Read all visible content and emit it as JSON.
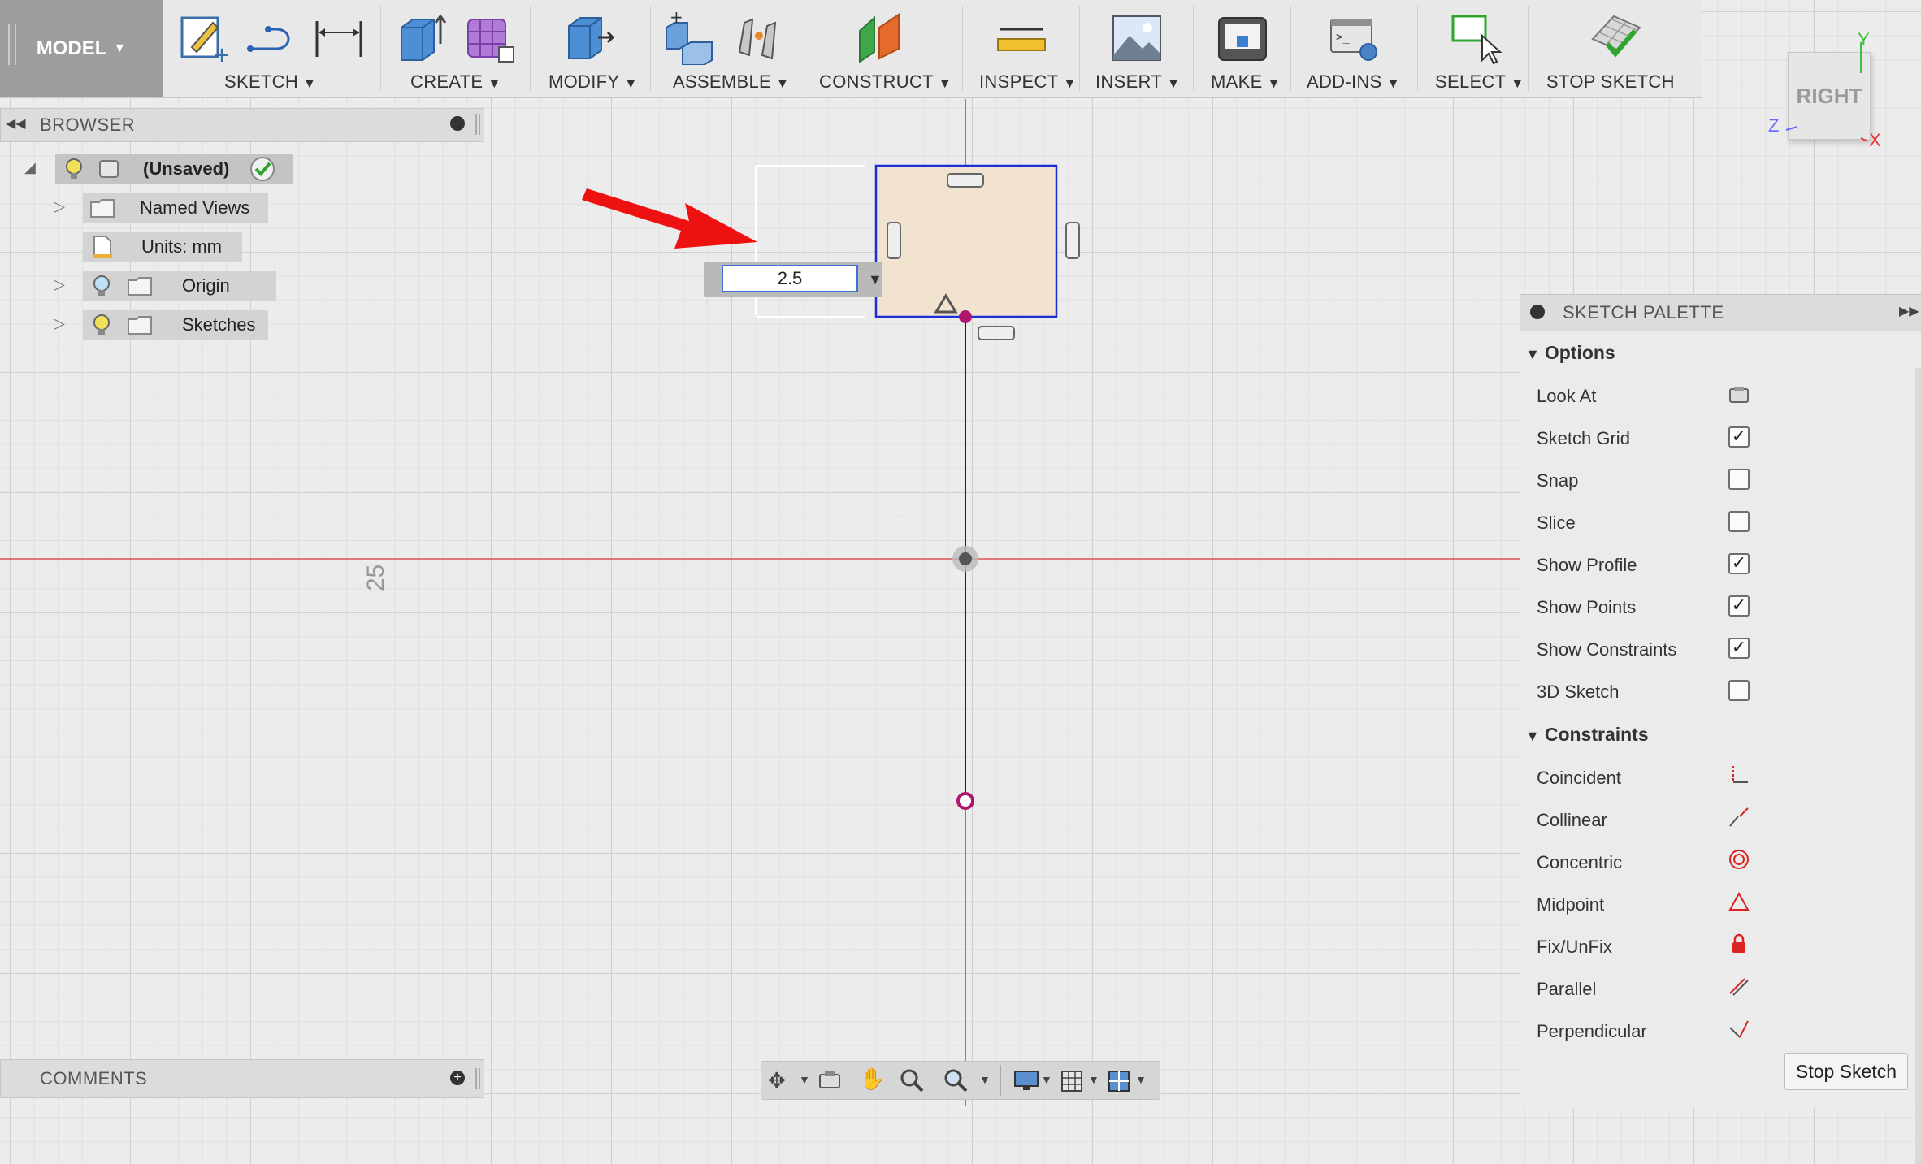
{
  "toolbar": {
    "model_label": "MODEL",
    "groups": [
      {
        "label": "SKETCH"
      },
      {
        "label": "CREATE"
      },
      {
        "label": "MODIFY"
      },
      {
        "label": "ASSEMBLE"
      },
      {
        "label": "CONSTRUCT"
      },
      {
        "label": "INSPECT"
      },
      {
        "label": "INSERT"
      },
      {
        "label": "MAKE"
      },
      {
        "label": "ADD-INS"
      },
      {
        "label": "SELECT"
      },
      {
        "label": "STOP SKETCH"
      }
    ]
  },
  "viewcube": {
    "face": "RIGHT",
    "axis_y": "Y",
    "axis_z": "Z",
    "axis_x": "X"
  },
  "browser": {
    "title": "BROWSER",
    "root": "(Unsaved)",
    "items": [
      {
        "label": "Named Views"
      },
      {
        "label": "Units: mm"
      },
      {
        "label": "Origin"
      },
      {
        "label": "Sketches"
      }
    ]
  },
  "canvas": {
    "dimension_value": "2.5",
    "grid_label": "25"
  },
  "palette": {
    "title": "SKETCH PALETTE",
    "options_header": "Options",
    "options": [
      {
        "label": "Look At",
        "control": "look-at-icon"
      },
      {
        "label": "Sketch Grid",
        "checked": true
      },
      {
        "label": "Snap",
        "checked": false
      },
      {
        "label": "Slice",
        "checked": false
      },
      {
        "label": "Show Profile",
        "checked": true
      },
      {
        "label": "Show Points",
        "checked": true
      },
      {
        "label": "Show Constraints",
        "checked": true
      },
      {
        "label": "3D Sketch",
        "checked": false
      }
    ],
    "constraints_header": "Constraints",
    "constraints": [
      {
        "label": "Coincident",
        "icon": "coincident-icon"
      },
      {
        "label": "Collinear",
        "icon": "collinear-icon"
      },
      {
        "label": "Concentric",
        "icon": "concentric-icon"
      },
      {
        "label": "Midpoint",
        "icon": "midpoint-icon"
      },
      {
        "label": "Fix/UnFix",
        "icon": "lock-icon"
      },
      {
        "label": "Parallel",
        "icon": "parallel-icon"
      },
      {
        "label": "Perpendicular",
        "icon": "perpendicular-icon"
      }
    ],
    "stop_button": "Stop Sketch"
  },
  "comments": {
    "title": "COMMENTS"
  },
  "colors": {
    "x_axis": "#d9534f",
    "y_axis": "#2fbf2f",
    "sketch_line": "#1c2fd6",
    "profile_fill": "#f2e2d0",
    "point": "#b0166e",
    "arrow": "#ee1111"
  }
}
